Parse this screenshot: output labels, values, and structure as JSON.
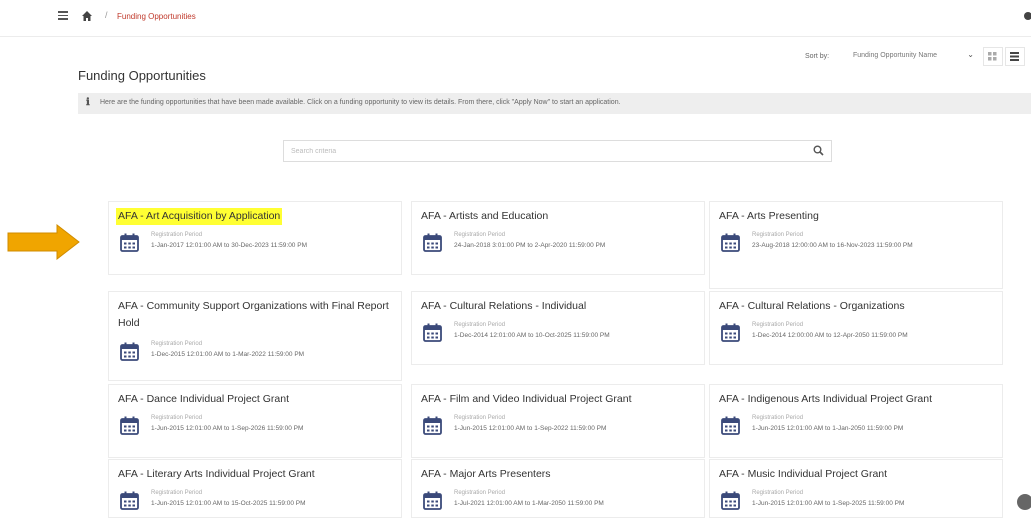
{
  "breadcrumb": {
    "current": "Funding Opportunities"
  },
  "sort": {
    "label": "Sort by:",
    "selected": "Funding Opportunity Name"
  },
  "page": {
    "title": "Funding Opportunities",
    "info": "Here are the funding opportunities that have been made available. Click on a funding opportunity to view its details. From there, click \"Apply Now\" to start an application."
  },
  "search": {
    "placeholder": "Search criteria"
  },
  "cards": [
    {
      "title": "AFA - Art Acquisition by Application",
      "reg_label": "Registration Period",
      "period": "1-Jan-2017 12:01:00 AM  to  30-Dec-2023 11:59:00 PM"
    },
    {
      "title": "AFA - Artists and Education",
      "reg_label": "Registration Period",
      "period": "24-Jan-2018 3:01:00 PM  to  2-Apr-2020 11:59:00 PM"
    },
    {
      "title": "AFA - Arts Presenting",
      "reg_label": "Registration Period",
      "period": "23-Aug-2018 12:00:00 AM  to  16-Nov-2023 11:59:00 PM"
    },
    {
      "title": "AFA - Community Support Organizations with Final Report Hold",
      "reg_label": "Registration Period",
      "period": "1-Dec-2015 12:01:00 AM  to  1-Mar-2022 11:59:00 PM"
    },
    {
      "title": "AFA - Cultural Relations - Individual",
      "reg_label": "Registration Period",
      "period": "1-Dec-2014 12:01:00 AM  to  10-Oct-2025 11:59:00 PM"
    },
    {
      "title": "AFA - Cultural Relations - Organizations",
      "reg_label": "Registration Period",
      "period": "1-Dec-2014 12:00:00 AM  to  12-Apr-2050 11:59:00 PM"
    },
    {
      "title": "AFA - Dance Individual Project Grant",
      "reg_label": "Registration Period",
      "period": "1-Jun-2015 12:01:00 AM  to  1-Sep-2026 11:59:00 PM"
    },
    {
      "title": "AFA - Film and Video Individual Project Grant",
      "reg_label": "Registration Period",
      "period": "1-Jun-2015 12:01:00 AM  to  1-Sep-2022 11:59:00 PM"
    },
    {
      "title": "AFA - Indigenous Arts Individual Project Grant",
      "reg_label": "Registration Period",
      "period": "1-Jun-2015 12:01:00 AM  to  1-Jan-2050 11:59:00 PM"
    },
    {
      "title": "AFA - Literary Arts Individual Project Grant",
      "reg_label": "Registration Period",
      "period": "1-Jun-2015 12:01:00 AM  to  15-Oct-2025 11:59:00 PM"
    },
    {
      "title": "AFA - Major Arts Presenters",
      "reg_label": "Registration Period",
      "period": "1-Jul-2021 12:01:00 AM  to  1-Mar-2050 11:59:00 PM"
    },
    {
      "title": "AFA - Music Individual Project Grant",
      "reg_label": "Registration Period",
      "period": "1-Jun-2015 12:01:00 AM  to  1-Sep-2025 11:59:00 PM"
    }
  ],
  "colors": {
    "highlight": "#ffff33",
    "arrow": "#f0a500",
    "breadcrumb": "#c0392b",
    "calendar": "#3b4a7a"
  }
}
